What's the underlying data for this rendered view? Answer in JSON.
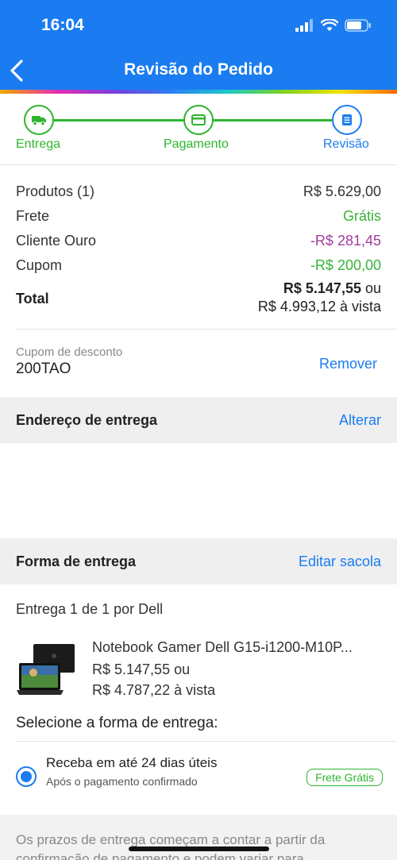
{
  "status_bar": {
    "time": "16:04"
  },
  "header": {
    "title": "Revisão do Pedido"
  },
  "steps": [
    {
      "label": "Entrega",
      "icon": "truck-icon"
    },
    {
      "label": "Pagamento",
      "icon": "card-icon"
    },
    {
      "label": "Revisão",
      "icon": "document-icon"
    }
  ],
  "summary": {
    "products_label": "Produtos (1)",
    "products_value": "R$ 5.629,00",
    "shipping_label": "Frete",
    "shipping_value": "Grátis",
    "gold_label": "Cliente Ouro",
    "gold_value": "-R$ 281,45",
    "coupon_label": "Cupom",
    "coupon_value": "-R$ 200,00",
    "total_label": "Total",
    "total_main": "R$ 5.147,55",
    "total_or": " ou",
    "total_cash": "R$ 4.993,12 à vista"
  },
  "coupon": {
    "label": "Cupom de desconto",
    "code": "200TAO",
    "remove": "Remover"
  },
  "address_section": {
    "title": "Endereço de entrega",
    "action": "Alterar"
  },
  "delivery_section": {
    "title": "Forma de entrega",
    "action": "Editar sacola"
  },
  "shipment": {
    "title": "Entrega 1 de 1",
    "seller_prefix": " por ",
    "seller": "Dell"
  },
  "product": {
    "name": "Notebook Gamer Dell G15-i1200-M10P...",
    "price": "R$ 5.147,55 ou",
    "cash": "R$ 4.787,22 à vista"
  },
  "select_title": "Selecione a forma de entrega:",
  "option": {
    "title": "Receba em até 24 dias úteis",
    "subtitle": "Após o pagamento confirmado",
    "badge": "Frete Grátis"
  },
  "info": "Os prazos de entrega começam a contar a partir da confirmação de pagamento e podem variar para",
  "colors": {
    "brand": "#1a7cf0",
    "success": "#2db52d",
    "discount": "#a23c9c"
  }
}
